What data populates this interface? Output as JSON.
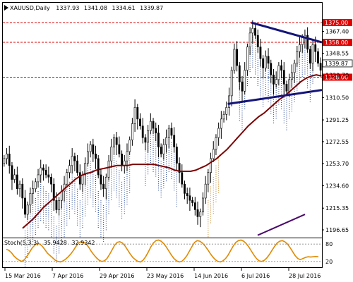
{
  "chart_data": {
    "type": "candlestick",
    "header": {
      "symbol": "XAUUSD,Daily",
      "open": "1337.93",
      "high": "1341.08",
      "low": "1334.61",
      "close": "1339.87"
    },
    "price_axis": {
      "ticks": [
        "1367.40",
        "1348.55",
        "1329.70",
        "1310.50",
        "1291.25",
        "1272.55",
        "1253.70",
        "1234.60",
        "1215.35",
        "1196.65"
      ],
      "range": [
        1190,
        1392
      ]
    },
    "levels": [
      {
        "label": "1375.00",
        "value": 1375.0,
        "color": "#e00000"
      },
      {
        "label": "1358.00",
        "value": 1358.0,
        "color": "#e00000"
      },
      {
        "label": "1328.00",
        "value": 1328.0,
        "color": "#e00000"
      }
    ],
    "current_price": {
      "label": "1339.87",
      "value": 1339.87
    },
    "dates": [
      "15 Mar 2016",
      "7 Apr 2016",
      "29 Apr 2016",
      "23 May 2016",
      "14 Jun 2016",
      "6 Jul 2016",
      "28 Jul 2016"
    ],
    "closes": [
      1258,
      1262,
      1252,
      1240,
      1244,
      1232,
      1236,
      1224,
      1210,
      1218,
      1228,
      1232,
      1238,
      1244,
      1250,
      1248,
      1244,
      1242,
      1236,
      1222,
      1214,
      1222,
      1230,
      1236,
      1246,
      1252,
      1260,
      1256,
      1246,
      1236,
      1244,
      1254,
      1264,
      1270,
      1262,
      1258,
      1244,
      1236,
      1232,
      1242,
      1256,
      1268,
      1276,
      1270,
      1262,
      1252,
      1256,
      1264,
      1274,
      1288,
      1302,
      1292,
      1286,
      1276,
      1272,
      1282,
      1290,
      1284,
      1280,
      1268,
      1262,
      1270,
      1276,
      1284,
      1278,
      1268,
      1254,
      1246,
      1236,
      1228,
      1226,
      1222,
      1220,
      1214,
      1208,
      1212,
      1224,
      1236,
      1246,
      1258,
      1266,
      1276,
      1284,
      1292,
      1296,
      1302,
      1312,
      1334,
      1352,
      1338,
      1324,
      1316,
      1334,
      1354,
      1366,
      1370,
      1364,
      1354,
      1344,
      1336,
      1346,
      1340,
      1330,
      1322,
      1326,
      1338,
      1334,
      1322,
      1316,
      1326,
      1332,
      1340,
      1350,
      1356,
      1362,
      1364,
      1352,
      1340,
      1356,
      1350,
      1340,
      1334
    ],
    "ma_line": [
      1198,
      1202,
      1206,
      1211,
      1216,
      1220,
      1224,
      1228,
      1232,
      1236,
      1240,
      1243,
      1245,
      1246,
      1248,
      1249,
      1250,
      1251,
      1252,
      1252,
      1252,
      1253,
      1253,
      1253,
      1253,
      1253,
      1252,
      1251,
      1250,
      1248,
      1247,
      1247,
      1247,
      1248,
      1250,
      1252,
      1255,
      1258,
      1262,
      1266,
      1271,
      1276,
      1281,
      1286,
      1290,
      1294,
      1297,
      1301,
      1305,
      1309,
      1312,
      1316,
      1320,
      1324,
      1327,
      1329,
      1330,
      1329
    ],
    "trend_lines": [
      {
        "name": "upper",
        "from": [
          95,
          1375
        ],
        "to": [
          122,
          1358
        ]
      },
      {
        "name": "lower",
        "from": [
          86,
          1305
        ],
        "to": [
          122,
          1317
        ]
      }
    ],
    "indicator": {
      "label": "Stoch(5,3,3)",
      "value1": "35.9428",
      "value2": "32.9342",
      "levels": [
        "80",
        "20"
      ],
      "range": [
        0,
        100
      ],
      "k": [
        62,
        58,
        50,
        38,
        30,
        24,
        20,
        26,
        38,
        52,
        66,
        76,
        82,
        80,
        72,
        60,
        48,
        40,
        32,
        24,
        20,
        18,
        22,
        28,
        36,
        46,
        58,
        72,
        84,
        88,
        86,
        80,
        68,
        54,
        42,
        32,
        24,
        20,
        22,
        30,
        44,
        60,
        76,
        86,
        88,
        84,
        74,
        60,
        46,
        34,
        26,
        20,
        18,
        24,
        36,
        52,
        70,
        84,
        92,
        94,
        90,
        82,
        70,
        56,
        42,
        30,
        22,
        18,
        20,
        28,
        40,
        56,
        72,
        86,
        92,
        90,
        84,
        74,
        62,
        48,
        36,
        26,
        20,
        18,
        22,
        30,
        42,
        58,
        74,
        86,
        92,
        94,
        90,
        82,
        70,
        56,
        42,
        30,
        22,
        20,
        24,
        32,
        44,
        58,
        72,
        84,
        90,
        92,
        88,
        80,
        68,
        54,
        40,
        30,
        26,
        30,
        34,
        36,
        35,
        36,
        37,
        36
      ]
    }
  }
}
